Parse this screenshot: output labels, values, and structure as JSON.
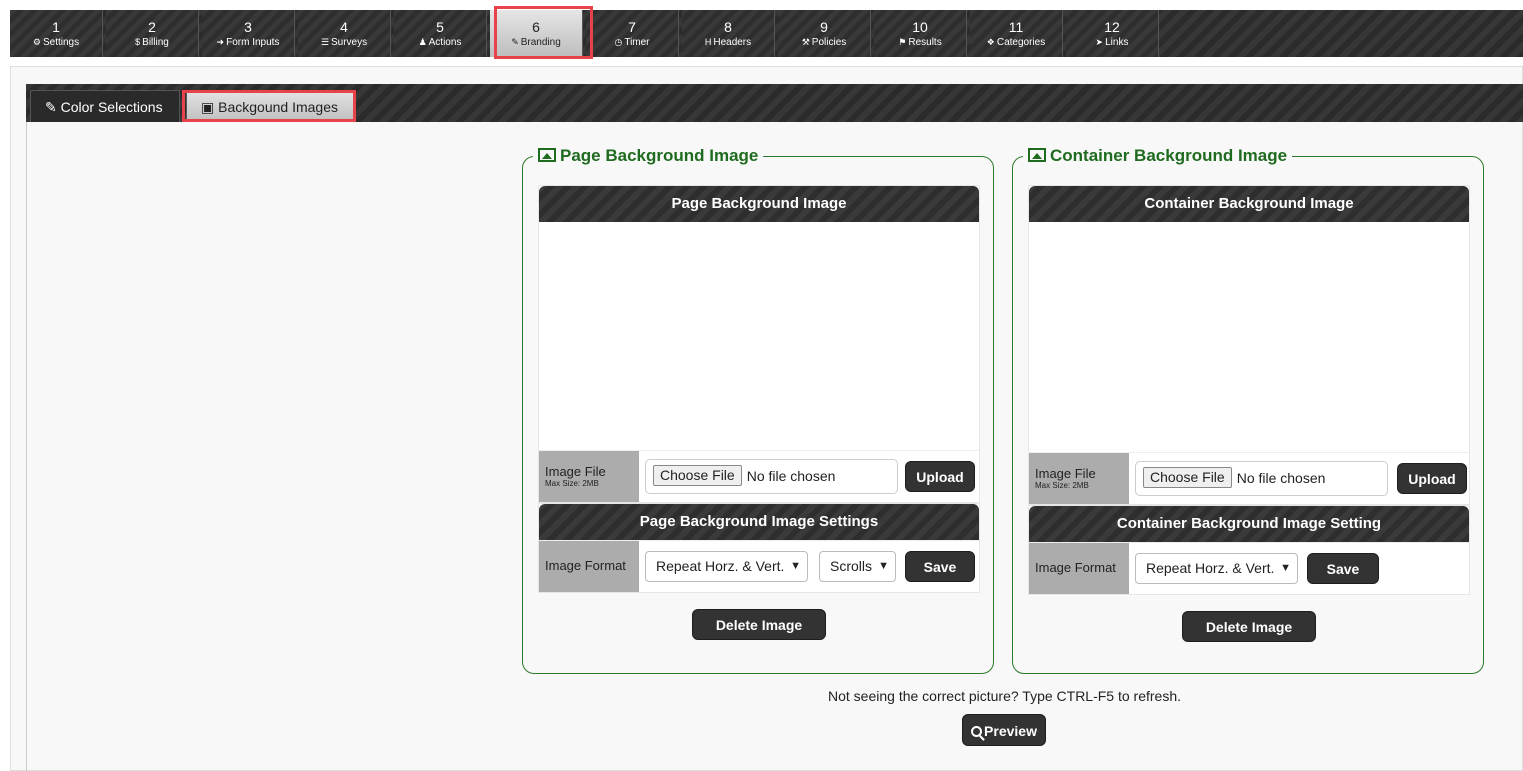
{
  "steps": [
    {
      "num": "1",
      "label": "Settings",
      "icon": "⚙"
    },
    {
      "num": "2",
      "label": "Billing",
      "icon": "$"
    },
    {
      "num": "3",
      "label": "Form Inputs",
      "icon": "➜"
    },
    {
      "num": "4",
      "label": "Surveys",
      "icon": "☰"
    },
    {
      "num": "5",
      "label": "Actions",
      "icon": "♟"
    },
    {
      "num": "6",
      "label": "Branding",
      "icon": "✎"
    },
    {
      "num": "7",
      "label": "Timer",
      "icon": "◷"
    },
    {
      "num": "8",
      "label": "Headers",
      "icon": "H"
    },
    {
      "num": "9",
      "label": "Policies",
      "icon": "⚒"
    },
    {
      "num": "10",
      "label": "Results",
      "icon": "⚑"
    },
    {
      "num": "11",
      "label": "Categories",
      "icon": "❖"
    },
    {
      "num": "12",
      "label": "Links",
      "icon": "➤"
    }
  ],
  "subtabs": {
    "color": {
      "label": "Color Selections",
      "icon": "✎"
    },
    "background": {
      "label": "Backgound Images",
      "icon": "▣"
    }
  },
  "page_bg": {
    "legend": "Page Background Image",
    "header": "Page Background Image",
    "image_file_label": "Image File",
    "max_size": "Max Size: 2MB",
    "choose_file": "Choose File",
    "no_file": "No file chosen",
    "upload": "Upload",
    "settings_header": "Page Background Image Settings",
    "image_format_label": "Image Format",
    "format_value": "Repeat Horz. & Vert.",
    "scroll_value": "Scrolls",
    "save": "Save",
    "delete": "Delete Image"
  },
  "container_bg": {
    "legend": "Container Background Image",
    "header": "Container Background Image",
    "image_file_label": "Image File",
    "max_size": "Max Size: 2MB",
    "choose_file": "Choose File",
    "no_file": "No file chosen",
    "upload": "Upload",
    "settings_header": "Container Background Image Setting",
    "image_format_label": "Image Format",
    "format_value": "Repeat Horz. & Vert.",
    "save": "Save",
    "delete": "Delete Image"
  },
  "note": "Not seeing the correct picture? Type CTRL-F5 to refresh.",
  "preview": "Preview",
  "colors": {
    "highlight": "#e8434a",
    "legend_green": "#1f6b1f",
    "dark": "#2e2e2e"
  }
}
